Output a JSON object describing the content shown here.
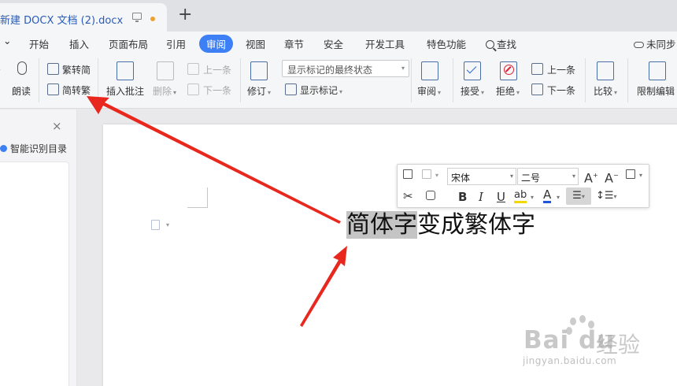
{
  "titlebar": {
    "tab_title": "新建 DOCX 文档 (2).docx",
    "new_tab": "+"
  },
  "menubar": {
    "collapse": "⌄",
    "items": [
      "开始",
      "插入",
      "页面布局",
      "引用",
      "审阅",
      "视图",
      "章节",
      "安全",
      "开发工具",
      "特色功能"
    ],
    "active": "审阅",
    "search": "查找",
    "sync": "未同步"
  },
  "ribbon": {
    "read_aloud": "朗读",
    "trad_to_simp": "繁转简",
    "simp_to_trad": "简转繁",
    "insert_comment": "插入批注",
    "delete": "删除",
    "prev_comment": "上一条",
    "next_comment": "下一条",
    "track_changes": "修订",
    "markup_mode": "显示标记的最终状态",
    "show_markup": "显示标记",
    "review_pane": "审阅",
    "accept": "接受",
    "reject": "拒绝",
    "prev_change": "上一条",
    "next_change": "下一条",
    "compare": "比较",
    "restrict_edit": "限制编辑"
  },
  "navpane": {
    "close": "×",
    "smart_toc": "智能识别目录"
  },
  "document": {
    "text_selected": "简体字",
    "text_rest": "变成繁体字"
  },
  "mini_toolbar": {
    "font": "宋体",
    "size": "二号",
    "grow": "A",
    "shrink": "A",
    "bold": "B",
    "italic": "I",
    "underline": "U",
    "highlight": "ab",
    "font_color": "A"
  },
  "watermark": {
    "brand": "Bai du",
    "brand_cn": "经验",
    "url": "jingyan.baidu.com"
  },
  "colors": {
    "accent": "#3d7ff5",
    "arrow": "#e8281e",
    "selection": "#c4c4c4",
    "tab_title": "#2a5bb8"
  }
}
